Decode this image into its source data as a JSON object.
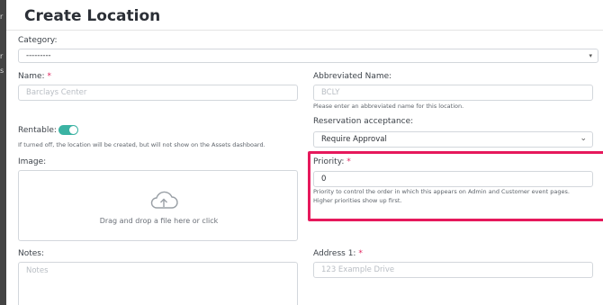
{
  "backdrop": {
    "ticks": [
      "r",
      "r",
      "s"
    ]
  },
  "modal": {
    "title": "Create Location"
  },
  "form": {
    "category": {
      "label": "Category:",
      "value": "---------"
    },
    "name": {
      "label": "Name:",
      "required_mark": "*",
      "placeholder": "Barclays Center"
    },
    "abbreviated_name": {
      "label": "Abbreviated Name:",
      "placeholder": "BCLY",
      "help": "Please enter an abbreviated name for this location."
    },
    "rentable": {
      "label": "Rentable:",
      "on": true,
      "help": "If turned off, the location will be created, but will not show on the Assets dashboard."
    },
    "reservation_acceptance": {
      "label": "Reservation acceptance:",
      "value": "Require Approval"
    },
    "image": {
      "label": "Image:",
      "dropzone_text": "Drag and drop a file here or click",
      "icon": "cloud-upload-icon"
    },
    "priority": {
      "label": "Priority:",
      "required_mark": "*",
      "value": "0",
      "help": "Priority to control the order in which this appears on Admin and Customer event pages. Higher priorities show up first."
    },
    "notes": {
      "label": "Notes:",
      "placeholder": "Notes"
    },
    "address1": {
      "label": "Address 1:",
      "required_mark": "*",
      "placeholder": "123 Example Drive"
    }
  },
  "colors": {
    "toggle": "#3bb3a3",
    "highlight": "#e6195c",
    "required": "#e0245e"
  }
}
